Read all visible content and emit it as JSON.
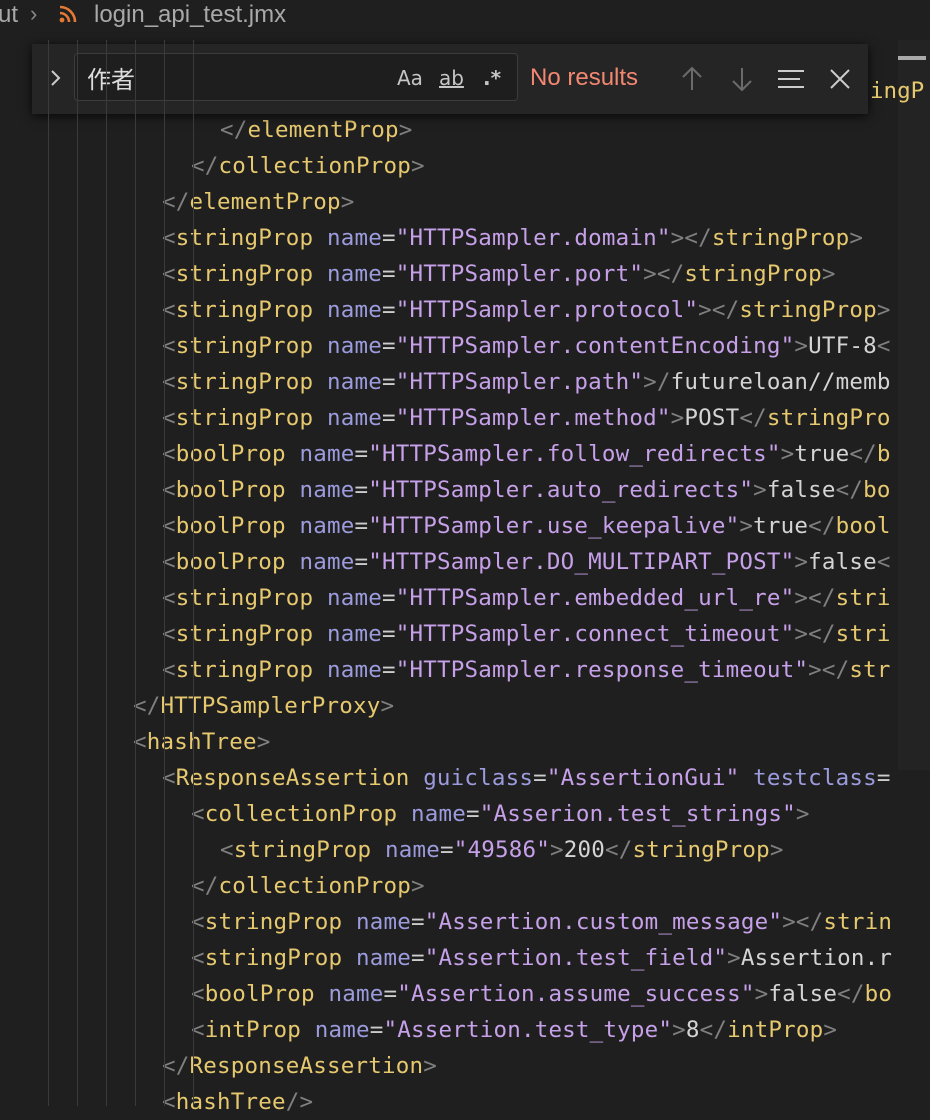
{
  "breadcrumb": {
    "prev": "ut",
    "file": "login_api_test.jmx"
  },
  "find": {
    "query": "作者",
    "match_case": "Aa",
    "whole_word": "ab",
    "regex": ".*",
    "status": "No results"
  },
  "editor": {
    "peek_text": "ingP",
    "lines": [
      "</elementProp>",
      "</collectionProp>",
      "</elementProp>",
      "<stringProp name=\"HTTPSampler.domain\"></stringProp>",
      "<stringProp name=\"HTTPSampler.port\"></stringProp>",
      "<stringProp name=\"HTTPSampler.protocol\"></stringProp>",
      "<stringProp name=\"HTTPSampler.contentEncoding\">UTF-8<",
      "<stringProp name=\"HTTPSampler.path\">/futureloan//memb",
      "<stringProp name=\"HTTPSampler.method\">POST</stringPro",
      "<boolProp name=\"HTTPSampler.follow_redirects\">true</b",
      "<boolProp name=\"HTTPSampler.auto_redirects\">false</bo",
      "<boolProp name=\"HTTPSampler.use_keepalive\">true</bool",
      "<boolProp name=\"HTTPSampler.DO_MULTIPART_POST\">false<",
      "<stringProp name=\"HTTPSampler.embedded_url_re\"></stri",
      "<stringProp name=\"HTTPSampler.connect_timeout\"></stri",
      "<stringProp name=\"HTTPSampler.response_timeout\"></str",
      "</HTTPSamplerProxy>",
      "<hashTree>",
      "<ResponseAssertion guiclass=\"AssertionGui\" testclass=",
      "<collectionProp name=\"Asserion.test_strings\">",
      "<stringProp name=\"49586\">200</stringProp>",
      "</collectionProp>",
      "<stringProp name=\"Assertion.custom_message\"></strin",
      "<stringProp name=\"Assertion.test_field\">Assertion.r",
      "<boolProp name=\"Assertion.assume_success\">false</bo",
      "<intProp name=\"Assertion.test_type\">8</intProp>",
      "</ResponseAssertion>",
      "<hashTree/>"
    ]
  },
  "colors": {
    "background": "#1f1f1f",
    "tag": "#e6c86e",
    "attribute": "#9b9bdd",
    "string": "#c6a0e8",
    "no_results": "#f48771"
  }
}
